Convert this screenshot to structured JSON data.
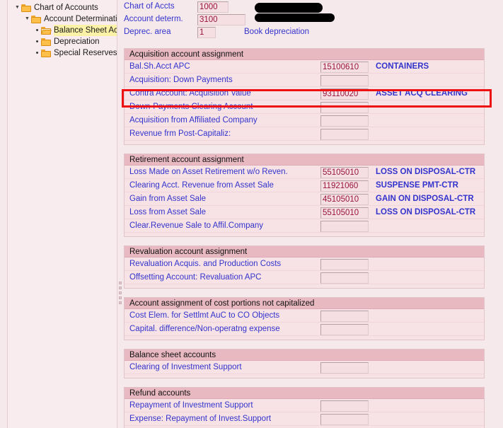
{
  "tree": {
    "items": [
      {
        "label": "Chart of Accounts",
        "indent": 0,
        "marker": "triangle-down",
        "icon": "folder-closed-icon",
        "selected": false
      },
      {
        "label": "Account Determinati",
        "indent": 1,
        "marker": "triangle-down",
        "icon": "folder-closed-icon",
        "selected": false
      },
      {
        "label": "Balance Sheet Acc",
        "indent": 2,
        "marker": "bullet",
        "icon": "folder-open-icon",
        "selected": true
      },
      {
        "label": "Depreciation",
        "indent": 2,
        "marker": "bullet",
        "icon": "folder-closed-icon",
        "selected": false
      },
      {
        "label": "Special Reserves",
        "indent": 2,
        "marker": "bullet",
        "icon": "folder-closed-icon",
        "selected": false
      }
    ]
  },
  "header": {
    "fields": [
      {
        "label": "Chart of Accts",
        "value": "1000",
        "width": 44
      },
      {
        "label": "Account determ.",
        "value": "3100",
        "width": 68
      },
      {
        "label": "Deprec. area",
        "value": "1",
        "width": 26
      }
    ],
    "deprec_area_description": "Book depreciation",
    "redacted_1": "",
    "redacted_2": ""
  },
  "sections": [
    {
      "title": "Acquisition account assignment",
      "rows": [
        {
          "label": "Bal.Sh.Acct APC",
          "value": "15100610",
          "description": "CONTAINERS"
        },
        {
          "label": "Acquisition: Down Payments",
          "value": "",
          "description": ""
        },
        {
          "label": "Contra Account: Acquisition Value",
          "value": "93110020",
          "description": "ASSET ACQ CLEARING"
        },
        {
          "label": "Down-Payments Clearing Account",
          "value": "",
          "description": ""
        },
        {
          "label": "Acquisition from Affiliated Company",
          "value": "",
          "description": ""
        },
        {
          "label": "Revenue frm Post-Capitaliz:",
          "value": "",
          "description": ""
        }
      ]
    },
    {
      "title": "Retirement account assignment",
      "rows": [
        {
          "label": "Loss Made on Asset Retirement w/o Reven.",
          "value": "55105010",
          "description": "LOSS ON DISPOSAL-CTR"
        },
        {
          "label": "Clearing Acct. Revenue from Asset Sale",
          "value": "11921060",
          "description": "SUSPENSE PMT-CTR"
        },
        {
          "label": "Gain from Asset Sale",
          "value": "45105010",
          "description": "GAIN ON DISPOSAL-CTR"
        },
        {
          "label": "Loss from Asset Sale",
          "value": "55105010",
          "description": "LOSS ON DISPOSAL-CTR"
        },
        {
          "label": "Clear.Revenue Sale to Affil.Company",
          "value": "",
          "description": ""
        }
      ]
    },
    {
      "title": "Revaluation account assignment",
      "rows": [
        {
          "label": "Revaluation Acquis. and Production Costs",
          "value": "",
          "description": ""
        },
        {
          "label": "Offsetting Account: Revaluation APC",
          "value": "",
          "description": ""
        }
      ]
    },
    {
      "title": "Account assignment of cost portions not capitalized",
      "rows": [
        {
          "label": "Cost Elem. for Settlmt AuC to CO Objects",
          "value": "",
          "description": ""
        },
        {
          "label": "Capital. difference/Non-operatng expense",
          "value": "",
          "description": ""
        }
      ]
    },
    {
      "title": "Balance sheet accounts",
      "rows": [
        {
          "label": "Clearing of Investment Support",
          "value": "",
          "description": ""
        }
      ]
    },
    {
      "title": "Refund accounts",
      "rows": [
        {
          "label": "Repayment of Investment Support",
          "value": "",
          "description": ""
        },
        {
          "label": "Expense: Repayment of Invest.Support",
          "value": "",
          "description": ""
        }
      ]
    }
  ],
  "colors": {
    "page_background": "#f6e9ec",
    "section_background": "#f7e3e6",
    "section_header": "#e9b9c2",
    "label_blue": "#3333cc",
    "value_maroon": "#99143c",
    "input_background": "#f5dfe3",
    "highlight_red": "#ee1111",
    "tree_selection_yellow": "#fbf2a8",
    "folder_orange": "#fcbf49"
  }
}
